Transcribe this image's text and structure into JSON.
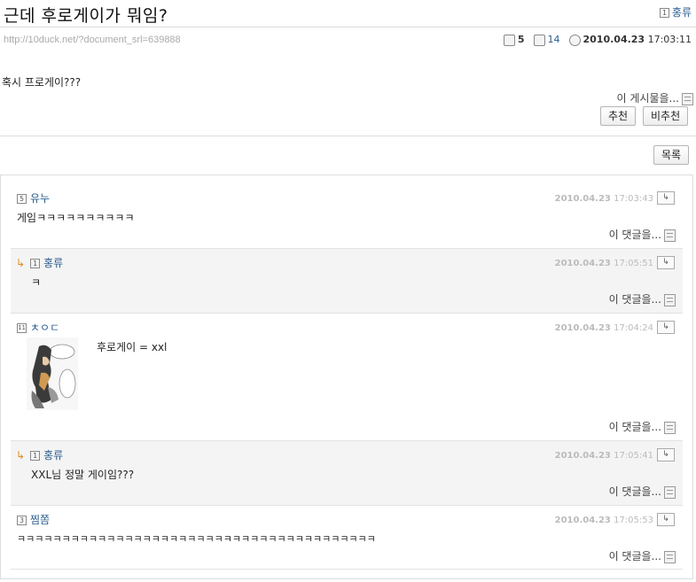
{
  "post": {
    "title": "근데 후로게이가 뭐임?",
    "author": "홍류",
    "author_level": "1",
    "url": "http://10duck.net/?document_srl=639888",
    "comment_count": "5",
    "read_count": "14",
    "date": "2010.04.23",
    "time": "17:03:11",
    "body": "혹시 프로게이???",
    "this_post_menu": "이 게시물을...",
    "recommend_label": "추천",
    "not_recommend_label": "비추천",
    "list_label": "목록"
  },
  "comments": [
    {
      "level": "5",
      "name": "유누",
      "date": "2010.04.23",
      "time": "17:03:43",
      "text": "게임ㅋㅋㅋㅋㅋㅋㅋㅋㅋㅋ",
      "menu": "이 댓글을...",
      "reply": false
    },
    {
      "level": "1",
      "name": "홍류",
      "date": "2010.04.23",
      "time": "17:05:51",
      "text": "ㅋ",
      "menu": "이 댓글을...",
      "reply": true
    },
    {
      "level": "11",
      "name": "ㅊㅇㄷ",
      "date": "2010.04.23",
      "time": "17:04:24",
      "text": "후로게이 = xxl",
      "menu": "이 댓글을...",
      "reply": false
    },
    {
      "level": "1",
      "name": "홍류",
      "date": "2010.04.23",
      "time": "17:05:41",
      "text": "XXL님 정말 게이임???",
      "menu": "이 댓글을...",
      "reply": true
    },
    {
      "level": "3",
      "name": "찜쫌",
      "date": "2010.04.23",
      "time": "17:05:53",
      "text": "ㅋㅋㅋㅋㅋㅋㅋㅋㅋㅋㅋㅋㅋㅋㅋㅋㅋㅋㅋㅋㅋㅋㅋㅋㅋㅋㅋㅋㅋㅋㅋㅋㅋㅋㅋㅋㅋㅋㅋㅋ",
      "menu": "이 댓글을...",
      "reply": false
    }
  ],
  "icons": {
    "comment": "comment-icon",
    "read": "read-count-icon",
    "clock": "clock-icon",
    "reply_arrow": "↳",
    "reply_button": "reply-icon"
  },
  "colors": {
    "author_link": "#2a5d8f",
    "reply_arrow": "#e08a1e",
    "reply_bg": "#f4f4f4"
  }
}
